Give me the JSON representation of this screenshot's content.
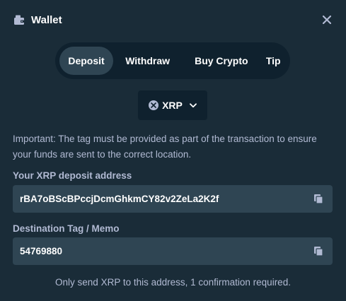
{
  "header": {
    "title": "Wallet",
    "icon": "wallet-icon",
    "close_icon": "close-icon"
  },
  "tabs": [
    {
      "label": "Deposit",
      "active": true
    },
    {
      "label": "Withdraw",
      "active": false
    },
    {
      "label": "Buy Crypto",
      "active": false
    },
    {
      "label": "Tip",
      "active": false
    }
  ],
  "currency": {
    "selected": "XRP",
    "icon": "xrp-icon",
    "dropdown_icon": "chevron-down-icon"
  },
  "notice": "Important: The tag must be provided as part of the transaction to ensure your funds are sent to the correct location.",
  "address": {
    "label": "Your XRP deposit address",
    "value": "rBA7oBScBPccjDcmGhkmCY82v2ZeLa2K2f",
    "copy_icon": "copy-icon"
  },
  "tag": {
    "label": "Destination Tag / Memo",
    "value": "54769880",
    "copy_icon": "copy-icon"
  },
  "footer": "Only send XRP to this address, 1 confirmation required.",
  "colors": {
    "background": "#1a2c38",
    "panel_dark": "#0f212e",
    "field_bg": "#2f4553",
    "text_muted": "#b1bad3",
    "text_white": "#ffffff"
  }
}
